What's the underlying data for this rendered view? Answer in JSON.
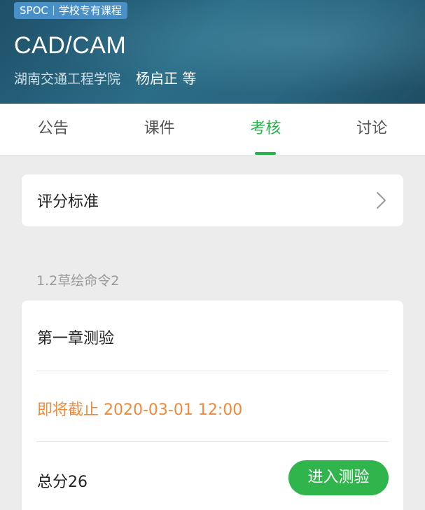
{
  "header": {
    "badge_type": "SPOC",
    "badge_desc": "学校专有课程",
    "course_title": "CAD/CAM",
    "school": "湖南交通工程学院",
    "teacher": "杨启正 等",
    "colors": {
      "badge_bg": "#4a90c8",
      "header_bg": "#2b6c86"
    }
  },
  "tabs": [
    {
      "label": "公告",
      "active": false
    },
    {
      "label": "课件",
      "active": false
    },
    {
      "label": "考核",
      "active": true
    },
    {
      "label": "讨论",
      "active": false
    }
  ],
  "criteria": {
    "label": "评分标准",
    "icon": "chevron-right-icon"
  },
  "section": {
    "label": "1.2草绘命令2"
  },
  "quiz": {
    "title": "第一章测验",
    "deadline": "即将截止 2020-03-01 12:00",
    "score": "总分26",
    "button_label": "进入测验"
  },
  "colors": {
    "accent": "#27b34a",
    "deadline": "#ef8a3a",
    "button": "#2fb54c"
  }
}
